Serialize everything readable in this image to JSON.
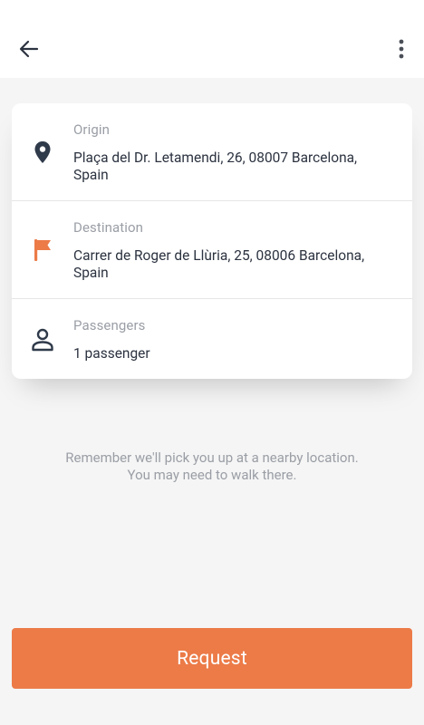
{
  "header": {
    "back_icon": "arrow-left-icon",
    "menu_icon": "more-vertical-icon"
  },
  "trip": {
    "origin": {
      "label": "Origin",
      "value": "Plaça del Dr. Letamendi, 26, 08007 Barcelona, Spain",
      "icon": "map-pin-icon"
    },
    "destination": {
      "label": "Destination",
      "value": "Carrer de Roger de Llùria, 25, 08006 Barcelona, Spain",
      "icon": "flag-icon"
    },
    "passengers": {
      "label": "Passengers",
      "value": "1 passenger",
      "icon": "person-icon"
    }
  },
  "note": "Remember we'll pick you up at a nearby location. You may need to walk there.",
  "request_label": "Request",
  "colors": {
    "accent": "#ec7b48",
    "icon_dark": "#2f3a4a",
    "muted_text": "#9a9ea5",
    "background": "#f5f5f5"
  }
}
